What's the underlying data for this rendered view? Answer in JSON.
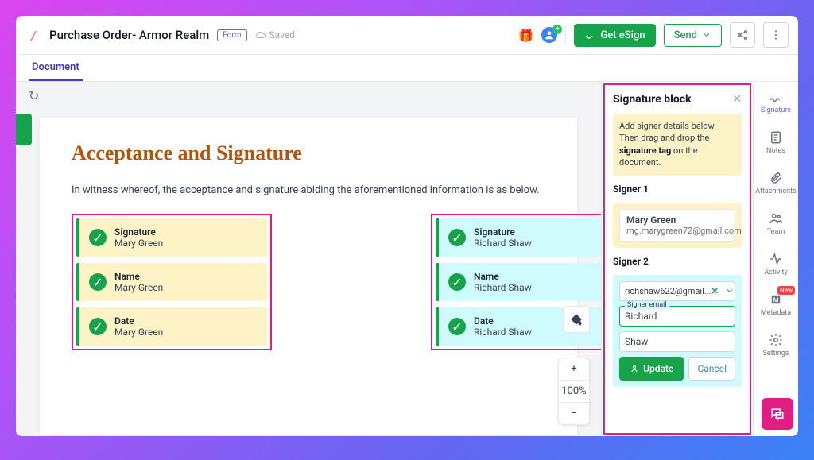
{
  "header": {
    "title": "Purchase Order- Armor Realm",
    "badge": "Form",
    "saved": "Saved",
    "get_esign": "Get eSign",
    "send": "Send"
  },
  "tabs": {
    "document": "Document"
  },
  "doc": {
    "heading": "Acceptance and Signature",
    "para": "In witness whereof, the acceptance and signature abiding the aforementioned information is as below.",
    "signer1_fields": [
      {
        "label": "Signature",
        "value": "Mary Green"
      },
      {
        "label": "Name",
        "value": "Mary Green"
      },
      {
        "label": "Date",
        "value": "Mary Green"
      }
    ],
    "signer2_fields": [
      {
        "label": "Signature",
        "value": "Richard Shaw"
      },
      {
        "label": "Name",
        "value": "Richard Shaw"
      },
      {
        "label": "Date",
        "value": "Richard Shaw"
      }
    ],
    "zoom": "100%"
  },
  "panel": {
    "title": "Signature block",
    "info_pre": "Add signer details below. Then drag and drop the ",
    "info_bold": "signature tag",
    "info_post": " on the document.",
    "signer1_label": "Signer 1",
    "signer1_name": "Mary Green",
    "signer1_email": "mg.marygreen72@gmail.com",
    "signer2_label": "Signer 2",
    "signer2_email": "richshaw622@gmail...",
    "first_label": "Signer email",
    "first_value": "Richard",
    "last_value": "Shaw",
    "update": "Update",
    "cancel": "Cancel"
  },
  "rail": {
    "signature": "Signature",
    "notes": "Notes",
    "attachments": "Attachments",
    "team": "Team",
    "activity": "Activity",
    "metadata": "Metadata",
    "settings": "Settings",
    "new": "New"
  }
}
